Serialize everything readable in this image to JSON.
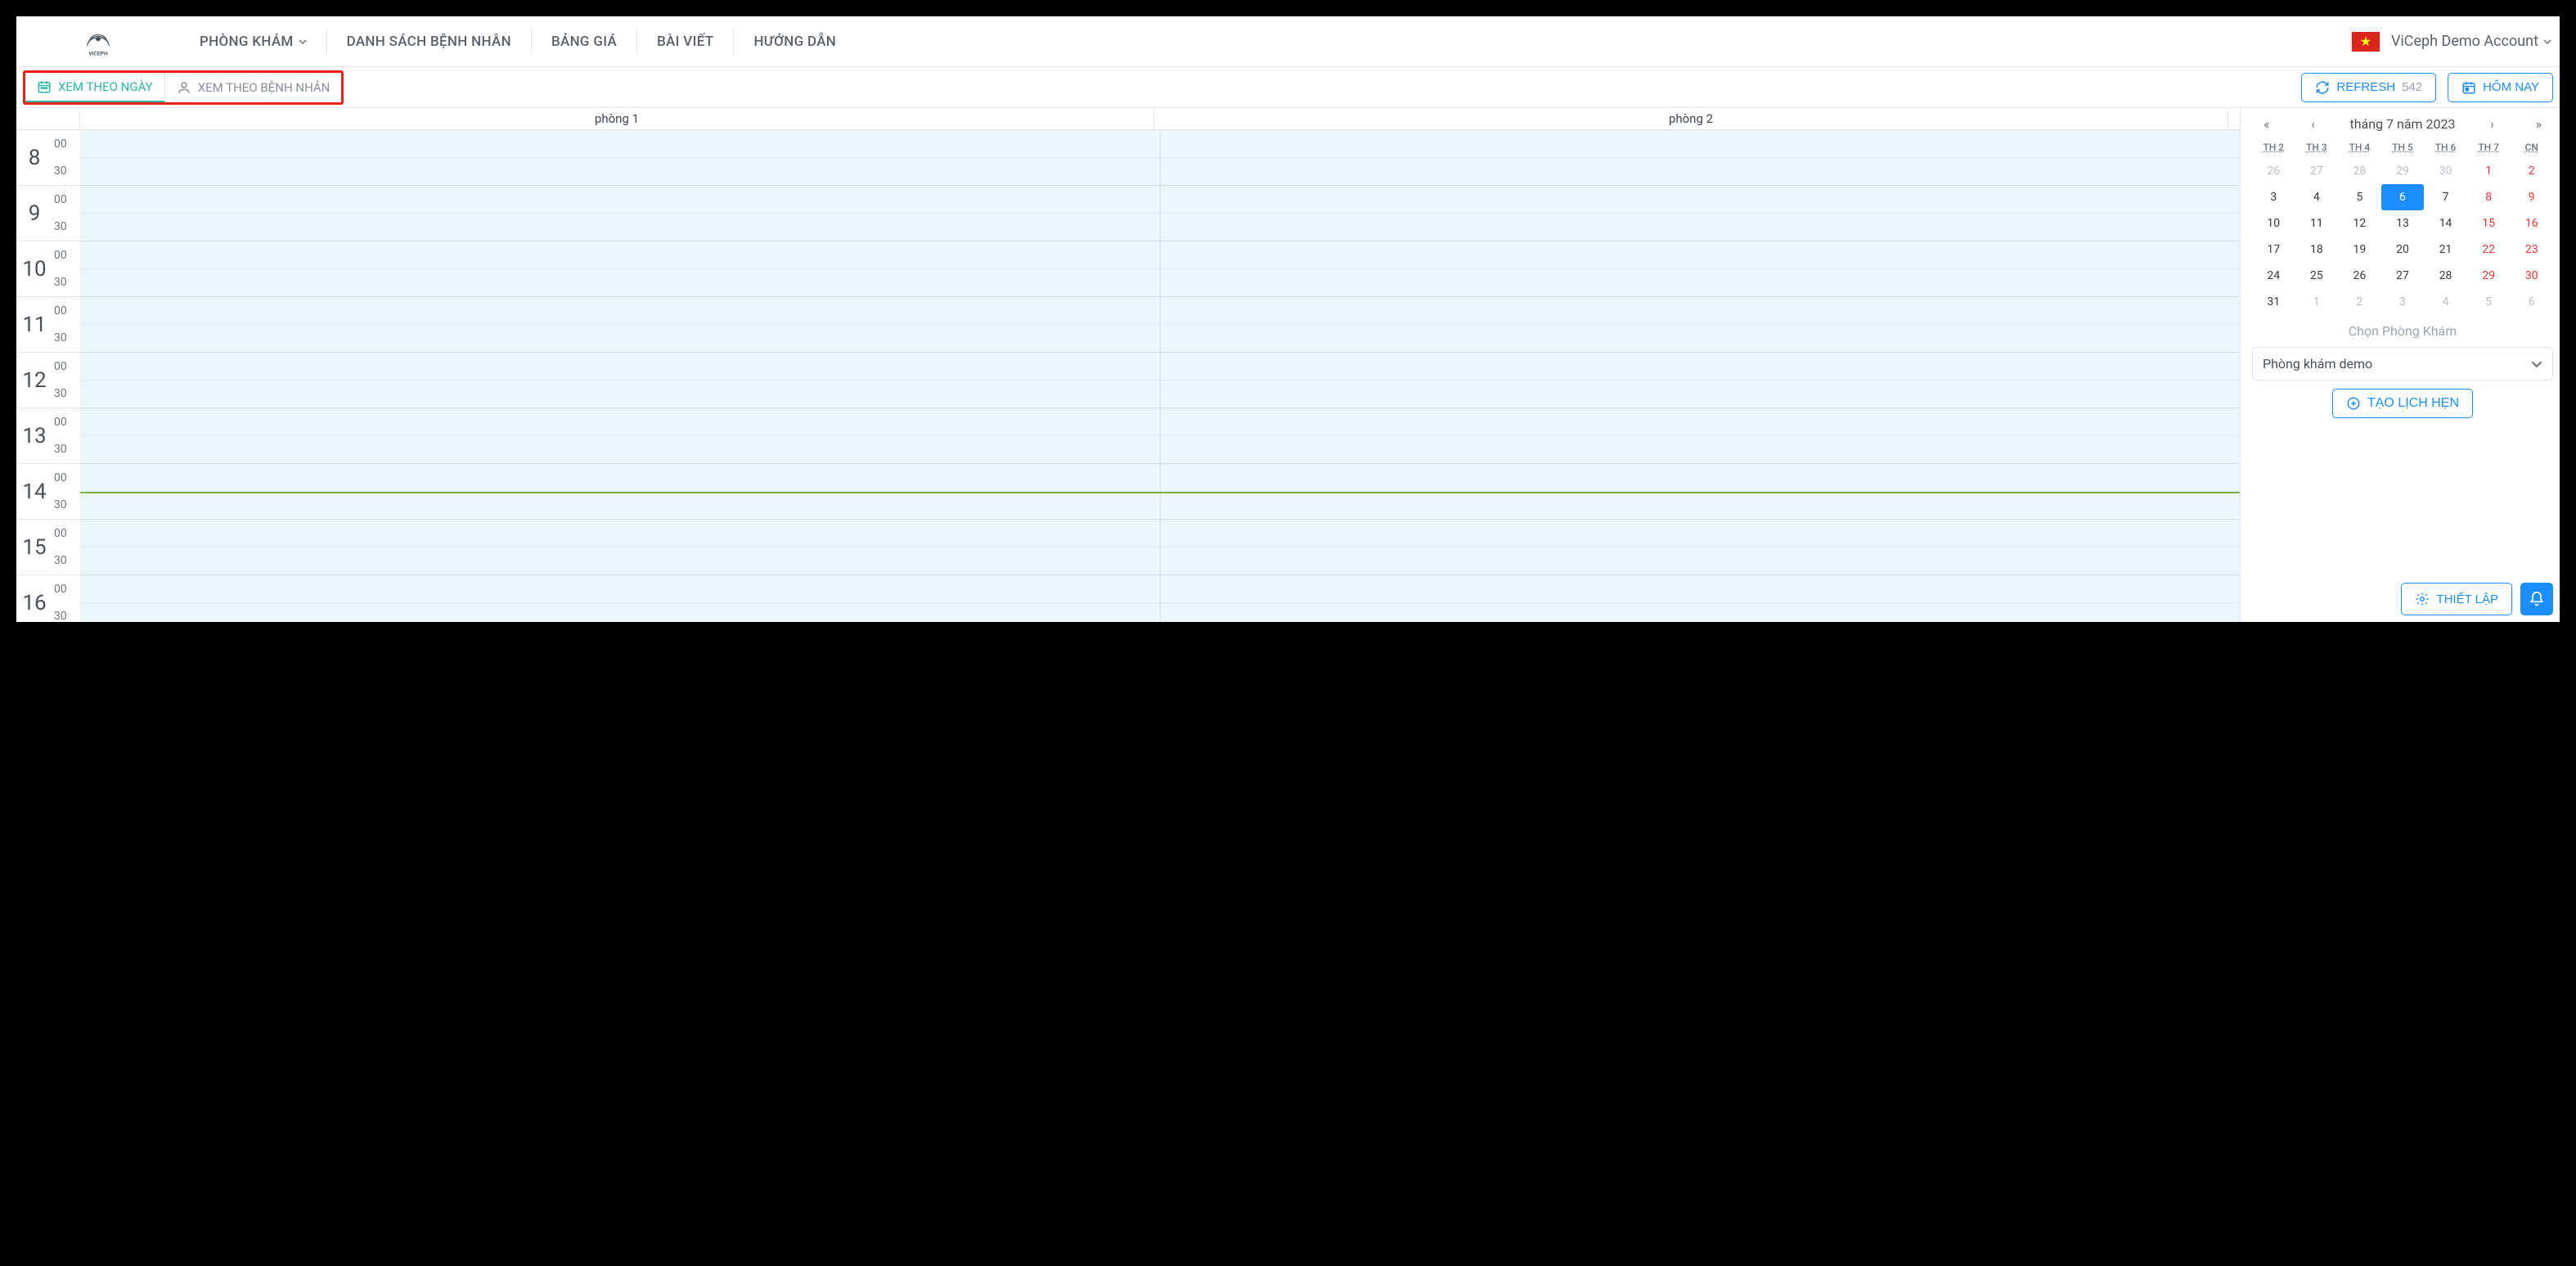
{
  "logo_name": "VICEPH",
  "topnav": {
    "items": [
      {
        "label": "PHÒNG KHÁM",
        "has_dropdown": true
      },
      {
        "label": "DANH SÁCH BỆNH NHÂN"
      },
      {
        "label": "BẢNG GIÁ"
      },
      {
        "label": "BÀI VIẾT"
      },
      {
        "label": "HƯỚNG DẪN"
      }
    ],
    "account_name": "ViCeph Demo Account"
  },
  "viewtabs": {
    "by_day": "XEM THEO NGÀY",
    "by_patient": "XEM THEO BỆNH NHÂN"
  },
  "toolbar": {
    "refresh_label": "REFRESH",
    "refresh_count": "542",
    "today_label": "HÔM NAY"
  },
  "rooms": [
    "phòng 1",
    "phòng 2"
  ],
  "hours": [
    "8",
    "9",
    "10",
    "11",
    "12",
    "13",
    "14",
    "15",
    "16"
  ],
  "minutes": [
    "00",
    "30"
  ],
  "now_row_index": 13,
  "calendar": {
    "title": "tháng 7 năm 2023",
    "nav": {
      "first": "«",
      "prev": "‹",
      "next": "›",
      "last": "»"
    },
    "dow": [
      "TH 2",
      "TH 3",
      "TH 4",
      "TH 5",
      "TH 6",
      "TH 7",
      "CN"
    ],
    "weeks": [
      [
        {
          "d": "26",
          "o": true
        },
        {
          "d": "27",
          "o": true
        },
        {
          "d": "28",
          "o": true
        },
        {
          "d": "29",
          "o": true
        },
        {
          "d": "30",
          "o": true
        },
        {
          "d": "1",
          "w": true
        },
        {
          "d": "2",
          "w": true
        }
      ],
      [
        {
          "d": "3"
        },
        {
          "d": "4"
        },
        {
          "d": "5"
        },
        {
          "d": "6",
          "sel": true
        },
        {
          "d": "7"
        },
        {
          "d": "8",
          "w": true
        },
        {
          "d": "9",
          "w": true
        }
      ],
      [
        {
          "d": "10"
        },
        {
          "d": "11"
        },
        {
          "d": "12"
        },
        {
          "d": "13"
        },
        {
          "d": "14"
        },
        {
          "d": "15",
          "w": true
        },
        {
          "d": "16",
          "w": true
        }
      ],
      [
        {
          "d": "17"
        },
        {
          "d": "18"
        },
        {
          "d": "19"
        },
        {
          "d": "20"
        },
        {
          "d": "21"
        },
        {
          "d": "22",
          "w": true
        },
        {
          "d": "23",
          "w": true
        }
      ],
      [
        {
          "d": "24"
        },
        {
          "d": "25"
        },
        {
          "d": "26"
        },
        {
          "d": "27"
        },
        {
          "d": "28"
        },
        {
          "d": "29",
          "w": true
        },
        {
          "d": "30",
          "w": true
        }
      ],
      [
        {
          "d": "31"
        },
        {
          "d": "1",
          "o": true
        },
        {
          "d": "2",
          "o": true
        },
        {
          "d": "3",
          "o": true
        },
        {
          "d": "4",
          "o": true
        },
        {
          "d": "5",
          "o": true
        },
        {
          "d": "6",
          "o": true
        }
      ]
    ]
  },
  "clinic_section_label": "Chọn Phòng Khám",
  "clinic_selected": "Phòng khám demo",
  "create_btn": "TẠO LỊCH HẸN",
  "settings_btn": "THIẾT LẬP"
}
